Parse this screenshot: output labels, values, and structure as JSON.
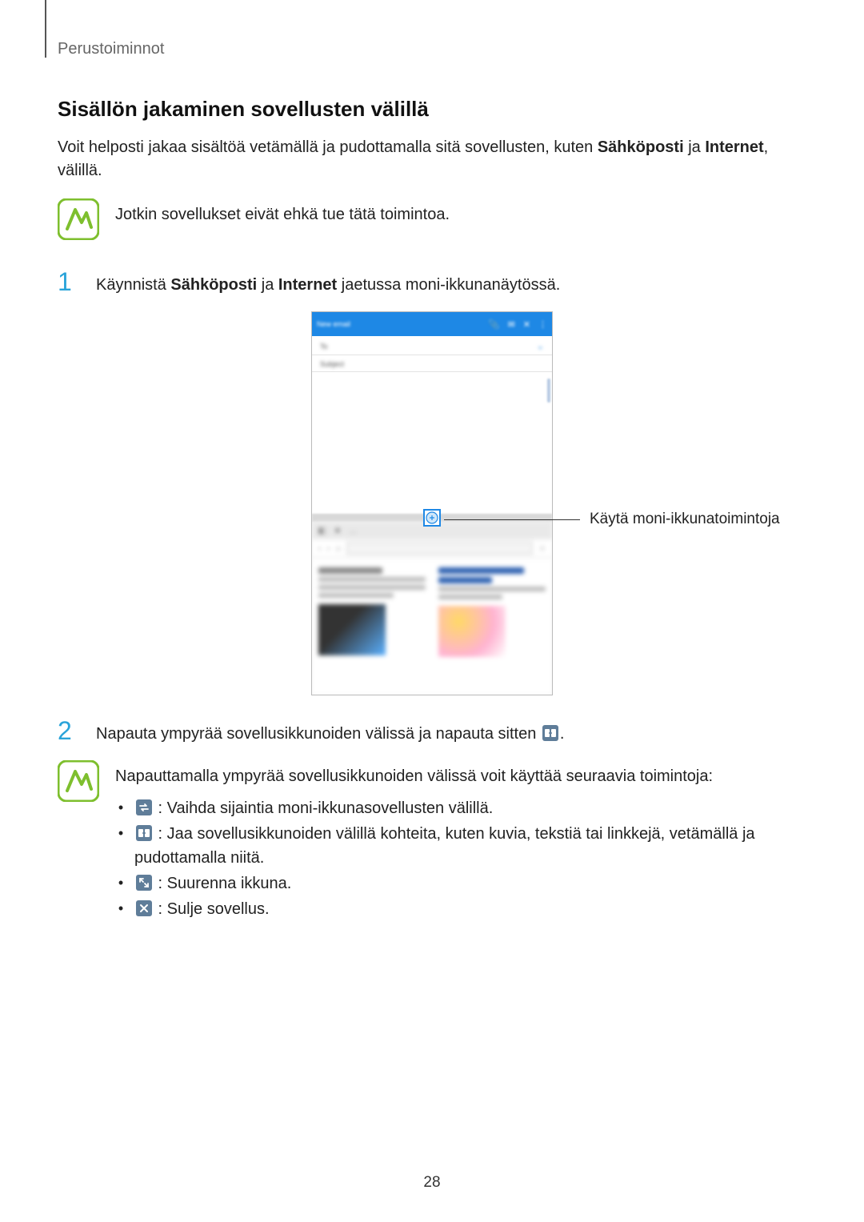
{
  "section_label": "Perustoiminnot",
  "heading": "Sisällön jakaminen sovellusten välillä",
  "intro": {
    "pre": "Voit helposti jakaa sisältöä vetämällä ja pudottamalla sitä sovellusten, kuten ",
    "bold1": "Sähköposti",
    "mid": " ja ",
    "bold2": "Internet",
    "post": ", välillä."
  },
  "note1": "Jotkin sovellukset eivät ehkä tue tätä toimintoa.",
  "step1": {
    "num": "1",
    "pre": "Käynnistä ",
    "bold1": "Sähköposti",
    "mid": " ja ",
    "bold2": "Internet",
    "post": " jaetussa moni-ikkunanäytössä."
  },
  "callout": "Käytä moni-ikkunatoimintoja",
  "figure": {
    "email_title": "New email",
    "to_label": "To",
    "subject_label": "Subject"
  },
  "step2": {
    "num": "2",
    "pre": "Napauta ympyrää sovellusikkunoiden välissä ja napauta sitten ",
    "post": "."
  },
  "note2_intro": "Napauttamalla ympyrää sovellusikkunoiden välissä voit käyttää seuraavia toimintoja:",
  "bullets": [
    {
      "icon": "swap-icon",
      "text": " : Vaihda sijaintia moni-ikkunasovellusten välillä."
    },
    {
      "icon": "share-window-icon",
      "text": " : Jaa sovellusikkunoiden välillä kohteita, kuten kuvia, tekstiä tai linkkejä, vetämällä ja pudottamalla niitä."
    },
    {
      "icon": "maximize-icon",
      "text": " : Suurenna ikkuna."
    },
    {
      "icon": "close-icon",
      "text": " : Sulje sovellus."
    }
  ],
  "page_number": "28"
}
